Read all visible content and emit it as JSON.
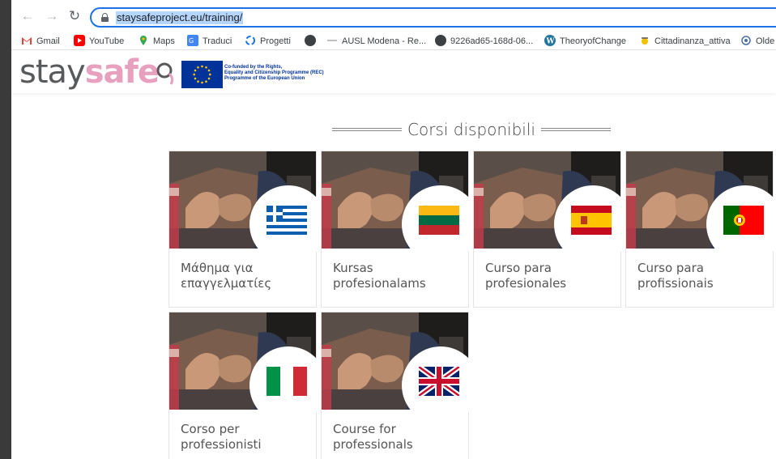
{
  "browser": {
    "url": "staysafeproject.eu/training/",
    "bookmarks": [
      {
        "label": "Gmail",
        "icon": "gmail-icon",
        "color": "#ea4335"
      },
      {
        "label": "YouTube",
        "icon": "youtube-icon",
        "color": "#ff0000"
      },
      {
        "label": "Maps",
        "icon": "maps-icon",
        "color": "#34a853"
      },
      {
        "label": "Traduci",
        "icon": "translate-icon",
        "color": "#4285f4"
      },
      {
        "label": "Progetti",
        "icon": "progetti-icon",
        "color": "#1a73e8"
      },
      {
        "label": "",
        "icon": "globe-icon",
        "color": "#5f6368"
      },
      {
        "label": "AUSL Modena - Re...",
        "icon": "ausl-icon",
        "color": "#a0a0a0"
      },
      {
        "label": "9226ad65-168d-06...",
        "icon": "globe-icon",
        "color": "#5f6368"
      },
      {
        "label": "TheoryofChange",
        "icon": "wordpress-icon",
        "color": "#21759b"
      },
      {
        "label": "Cittadinanza_attiva",
        "icon": "cittadinanza-icon",
        "color": "#e0a000"
      },
      {
        "label": "Olde",
        "icon": "olde-icon",
        "color": "#4a6fa5"
      }
    ]
  },
  "site": {
    "logo_plain": "stay",
    "logo_pink": "safe",
    "eu_text_line1": "Co-funded by the Rights,",
    "eu_text_line2": "Equality and Citizenship Programme (REC)",
    "eu_text_line3": "Programme of the European Union",
    "section_title": "Corsi disponibili"
  },
  "courses": [
    {
      "line1": "Μάθημα για",
      "line2": "επαγγελματίες",
      "flag": "greece"
    },
    {
      "line1": "Kursas",
      "line2": "profesionalams",
      "flag": "lithuania"
    },
    {
      "line1": "Curso para",
      "line2": "profesionales",
      "flag": "spain"
    },
    {
      "line1": "Curso para",
      "line2": "profissionais",
      "flag": "portugal"
    },
    {
      "line1": "Corso per",
      "line2": "professionisti",
      "flag": "italy"
    },
    {
      "line1": "Course for",
      "line2": "professionals",
      "flag": "uk"
    }
  ]
}
